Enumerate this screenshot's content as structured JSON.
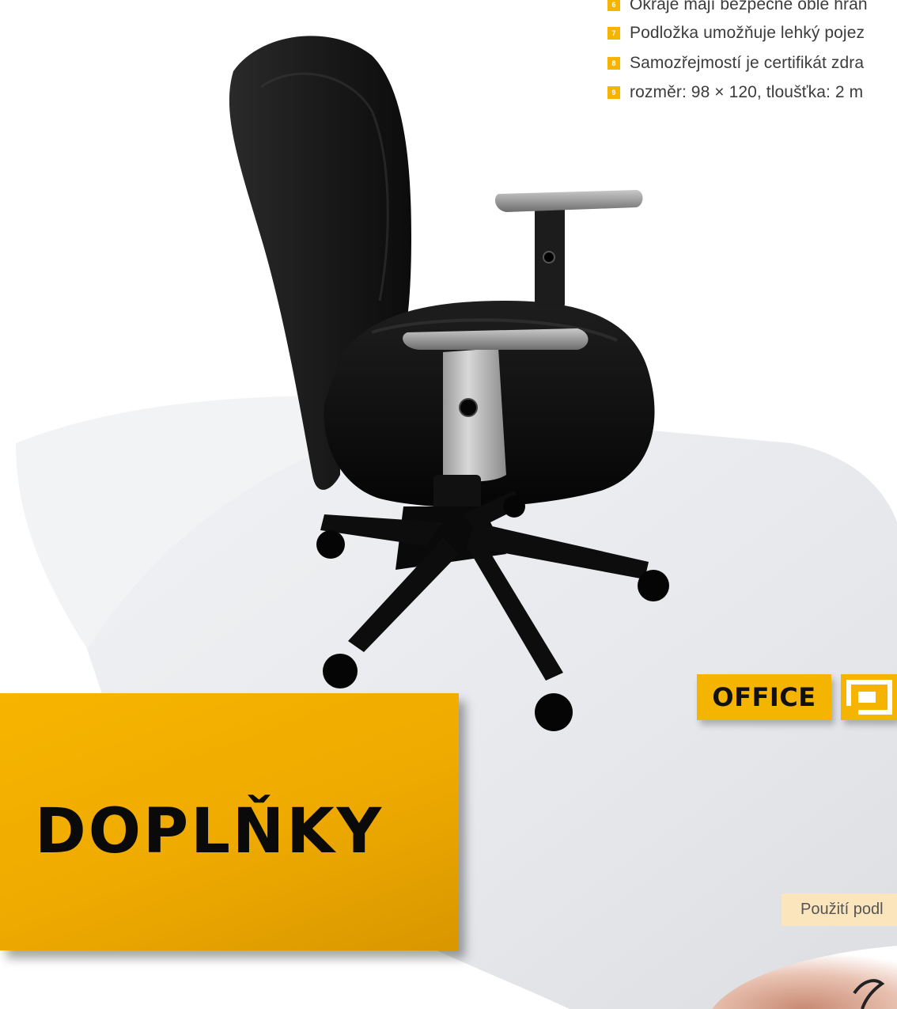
{
  "features": [
    {
      "num": "6",
      "text": "Okraje mají bezpečné oblé hran"
    },
    {
      "num": "7",
      "text": "Podložka umožňuje lehký pojez"
    },
    {
      "num": "8",
      "text": "Samozřejmostí je certifikát zdra"
    },
    {
      "num": "9",
      "text": "rozměr: 98 × 120, tloušťka: 2 m"
    }
  ],
  "badge": {
    "label": "OFFICE"
  },
  "section": {
    "title": "DOPLŇKY"
  },
  "caption": {
    "text": "Použití podl"
  },
  "colors": {
    "accent": "#f5b400",
    "caption_bg": "#fbe5bc",
    "text": "#3c3c3c"
  }
}
